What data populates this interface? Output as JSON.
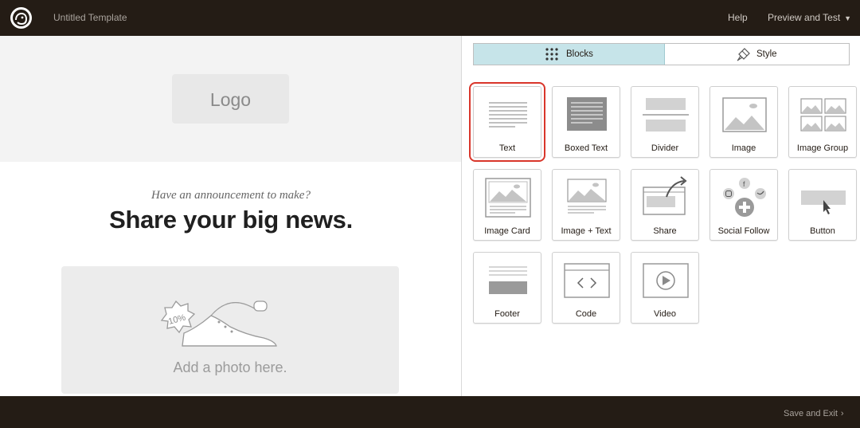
{
  "header": {
    "title": "Untitled Template",
    "help_label": "Help",
    "preview_label": "Preview and Test",
    "preview_chevron_icon": "chevron-down-icon",
    "logo_icon": "freddie-logo-icon"
  },
  "canvas": {
    "logo_placeholder": "Logo",
    "announcement": "Have an announcement to make?",
    "headline": "Share your big news.",
    "photo_placeholder": "Add a photo here.",
    "photo_badge_text": "10%"
  },
  "panel": {
    "tabs": [
      {
        "label": "Blocks",
        "icon": "grid-dots-icon",
        "active": true
      },
      {
        "label": "Style",
        "icon": "paint-brush-icon",
        "active": false
      }
    ],
    "blocks": [
      {
        "label": "Text",
        "icon": "text-block-icon",
        "selected": true
      },
      {
        "label": "Boxed Text",
        "icon": "boxed-text-block-icon",
        "selected": false
      },
      {
        "label": "Divider",
        "icon": "divider-block-icon",
        "selected": false
      },
      {
        "label": "Image",
        "icon": "image-block-icon",
        "selected": false
      },
      {
        "label": "Image Group",
        "icon": "image-group-block-icon",
        "selected": false
      },
      {
        "label": "Image Card",
        "icon": "image-card-block-icon",
        "selected": false
      },
      {
        "label": "Image + Text",
        "icon": "image-text-block-icon",
        "selected": false
      },
      {
        "label": "Share",
        "icon": "share-block-icon",
        "selected": false
      },
      {
        "label": "Social Follow",
        "icon": "social-follow-block-icon",
        "selected": false
      },
      {
        "label": "Button",
        "icon": "button-block-icon",
        "selected": false
      },
      {
        "label": "Footer",
        "icon": "footer-block-icon",
        "selected": false
      },
      {
        "label": "Code",
        "icon": "code-block-icon",
        "selected": false
      },
      {
        "label": "Video",
        "icon": "video-block-icon",
        "selected": false
      }
    ]
  },
  "footer": {
    "save_exit_label": "Save and Exit",
    "chevron_icon": "chevron-right-icon"
  },
  "colors": {
    "topbar": "#241c15",
    "active_tab": "#c6e4e9",
    "selection_outline": "#d9362b"
  }
}
